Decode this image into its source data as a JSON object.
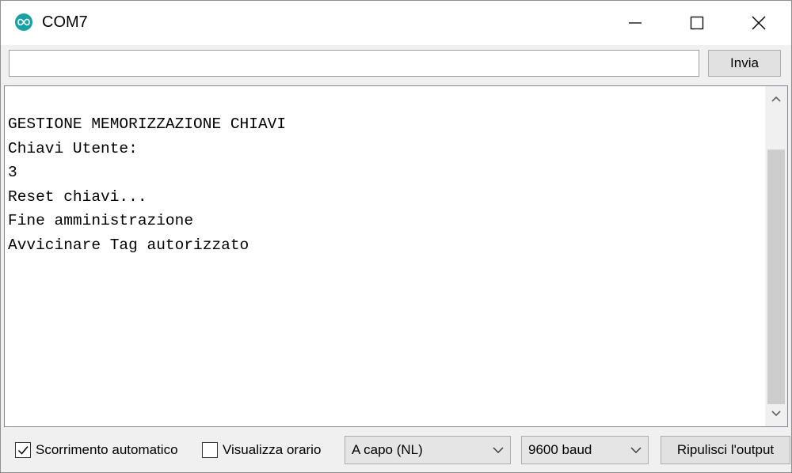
{
  "window": {
    "title": "COM7",
    "icon": "arduino-logo-icon",
    "controls": {
      "minimize": "minimize-icon",
      "maximize": "maximize-icon",
      "close": "close-icon"
    }
  },
  "send": {
    "input_value": "",
    "button_label": "Invia"
  },
  "output": {
    "lines": [
      "GESTIONE MEMORIZZAZIONE CHIAVI",
      "Chiavi Utente:",
      "3",
      "Reset chiavi...",
      "Fine amministrazione",
      "Avvicinare Tag autorizzato"
    ]
  },
  "footer": {
    "autoscroll": {
      "label": "Scorrimento automatico",
      "checked": true
    },
    "timestamp": {
      "label": "Visualizza orario",
      "checked": false
    },
    "line_ending": {
      "selected": "A capo (NL)"
    },
    "baud_rate": {
      "selected": "9600 baud"
    },
    "clear_button_label": "Ripulisci l'output"
  },
  "colors": {
    "accent": "#17a1a5",
    "background": "#f0f0f0",
    "output_background": "#ffffff"
  }
}
